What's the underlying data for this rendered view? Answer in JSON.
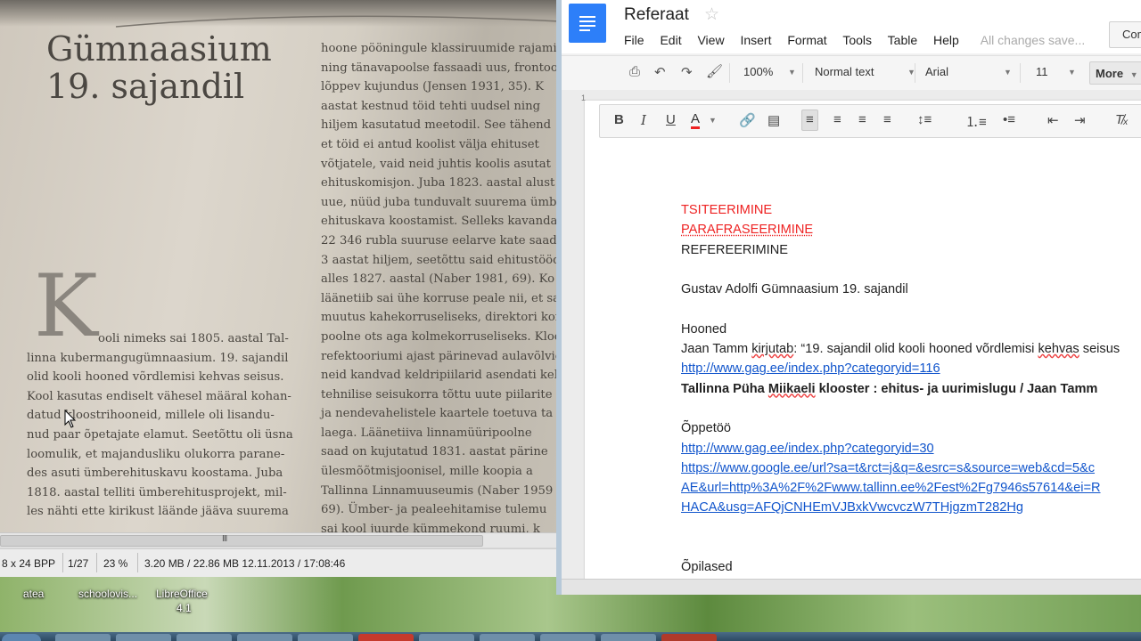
{
  "viewer": {
    "book": {
      "title_line1": "Gümnaasium",
      "title_line2": "19. sajandil",
      "drop_cap": "K",
      "left_column": [
        "ooli nimeks sai 1805. aastal Tal-",
        "linna kubermangugümnaasium. 19. sajandil",
        "olid kooli hooned võrdlemisi kehvas seisus.",
        "Kool kasutas endiselt vähesel määral kohan-",
        "datud kloostrihooneid, millele oli lisandu-",
        "nud paar õpetajate elamut. Seetõttu oli üsna",
        "loomulik, et majandusliku olukorra parane-",
        "des asuti ümberehituskavu koostama. Juba",
        "1818. aastal telliti ümberehitusprojekt, mil-",
        "les nähti ette kirikust läände jääva suurema"
      ],
      "right_column": [
        "hoone pööningule klassiruumide rajami",
        "ning tänavapoolse fassaadi uus, frontoonig",
        "lõppev kujundus (Jensen 1931, 35). K",
        "aastat kestnud töid tehti uudsel ning",
        "hiljem kasutatud meetodil. See tähend",
        "et töid ei antud koolist välja ehituset",
        "võtjatele, vaid neid juhtis koolis asutat",
        "ehituskomisjon. Juba 1823. aastal alust",
        "uue, nüüd juba tunduvalt suurema ümbe",
        "ehituskava koostamist. Selleks kavandat",
        "22 346 rubla suuruse eelarve kate saadi",
        "3 aastat hiljem, seetõttu said ehitustööd al",
        "alles 1827. aastal (Naber 1981, 69). Ko",
        "läänetiib sai ühe korruse peale nii, et saali",
        "muutus kahekorruseliseks, direktori korte",
        "poolne ots aga kolmekorruseliseks. Klooste",
        "refektooriumi ajast pärinevad aulavõlvid",
        "neid kandvad keldripiilarid asendati kell",
        "tehnilise seisukorra tõttu uute piilarite",
        "ja nendevahelistele kaartele toetuva ta",
        "laega. Läänetiiva linnamüüripoolne",
        "saad on kujutatud 1831. aastat pärine",
        "ülesmõõtmisjoonisel, mille koopia a",
        "Tallinna Linnamuuseumis (Naber 1959",
        "69). Ümber- ja pealeehitamise tulemu",
        "sai kool juurde kümmekond ruumi, k"
      ]
    },
    "status": {
      "bpp": "8 x 24 BPP",
      "page": "1/27",
      "zoom": "23 %",
      "size_date": "3.20 MB / 22.86 MB 12.11.2013 / 17:08:46"
    },
    "scroll_grip": "III"
  },
  "desktop": {
    "icons": [
      "atea",
      "schoolovis...",
      "LibreOffice",
      "4.1"
    ]
  },
  "docs": {
    "title": "Referaat",
    "menu": [
      "File",
      "Edit",
      "View",
      "Insert",
      "Format",
      "Tools",
      "Table",
      "Help"
    ],
    "saved_status": "All changes save...",
    "comments_button": "Com",
    "toolbar": {
      "zoom": "100%",
      "style": "Normal text",
      "font": "Arial",
      "font_size": "11",
      "more": "More"
    },
    "ruler_number": "1",
    "body": {
      "line1": "TSITEERIMINE",
      "line2": "PARAFRASEERIMINE",
      "line3": "REFEREERIMINE",
      "line4": "Gustav Adolfi Gümnaasium 19. sajandil",
      "heading_hooned": "Hooned",
      "quote_prefix": "Jaan Tamm ",
      "quote_word": "kirjutab",
      "quote_mid": ": “19. sajandil olid kooli hooned võrdlemisi ",
      "quote_word2": "kehvas",
      "quote_end": " seisus",
      "link1": "http://www.gag.ee/index.php?categoryid=116",
      "bold_prefix": "Tallinna Püha ",
      "bold_word": "Miikaeli",
      "bold_suffix": " klooster : ehitus- ja uurimislugu / Jaan Tamm",
      "heading_oppetoo": "Õppetöö",
      "link2": "http://www.gag.ee/index.php?categoryid=30",
      "link3_line1": "https://www.google.ee/url?sa=t&rct=j&q=&esrc=s&source=web&cd=5&c",
      "link3_line2": "AE&url=http%3A%2F%2Fwww.tallinn.ee%2Fest%2Fg7946s57614&ei=R",
      "link3_line3": "HACA&usg=AFQjCNHEmVJBxkVwcvczW7THjgzmT282Hg",
      "heading_opilased": "Õpilased"
    }
  }
}
